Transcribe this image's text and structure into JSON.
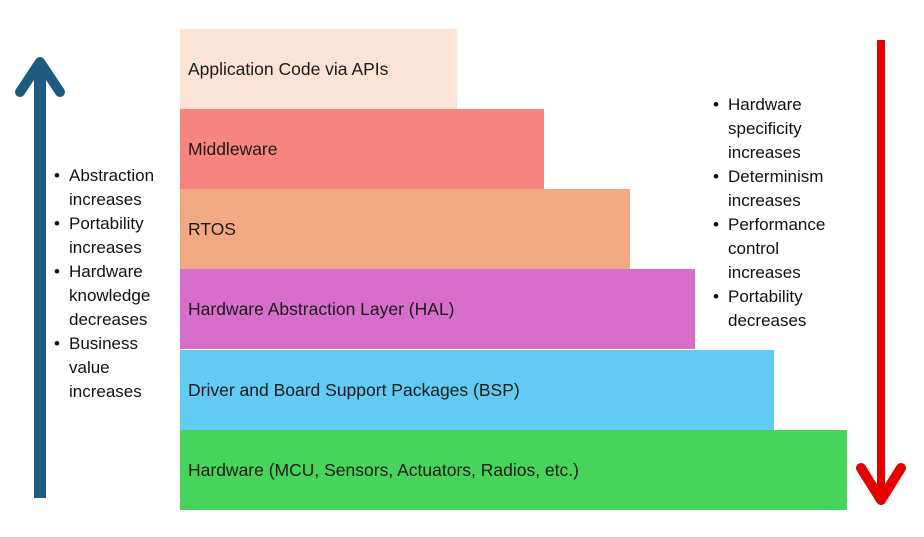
{
  "layers": [
    {
      "label": "Application Code via APIs",
      "color": "#fbe3d6"
    },
    {
      "label": "Middleware",
      "color": "#f6847f"
    },
    {
      "label": "RTOS",
      "color": "#f1a983"
    },
    {
      "label": "Hardware Abstraction Layer (HAL)",
      "color": "#d86ecc"
    },
    {
      "label": "Driver and Board Support Packages (BSP)",
      "color": "#61cbf3"
    },
    {
      "label": "Hardware (MCU, Sensors, Actuators, Radios, etc.)",
      "color": "#47d45a"
    }
  ],
  "left_arrow": {
    "color": "#1d5c7e",
    "direction": "up"
  },
  "right_arrow": {
    "color": "#e60000",
    "direction": "down"
  },
  "left_bullets": [
    [
      "Abstraction",
      "increases"
    ],
    [
      "Portability",
      "increases"
    ],
    [
      "Hardware",
      "knowledge",
      "decreases"
    ],
    [
      "Business",
      "value",
      "increases"
    ]
  ],
  "right_bullets": [
    [
      "Hardware",
      "specificity",
      "increases"
    ],
    [
      "Determinism",
      "increases"
    ],
    [
      "Performance",
      "control",
      "increases"
    ],
    [
      "Portability",
      "decreases"
    ]
  ]
}
